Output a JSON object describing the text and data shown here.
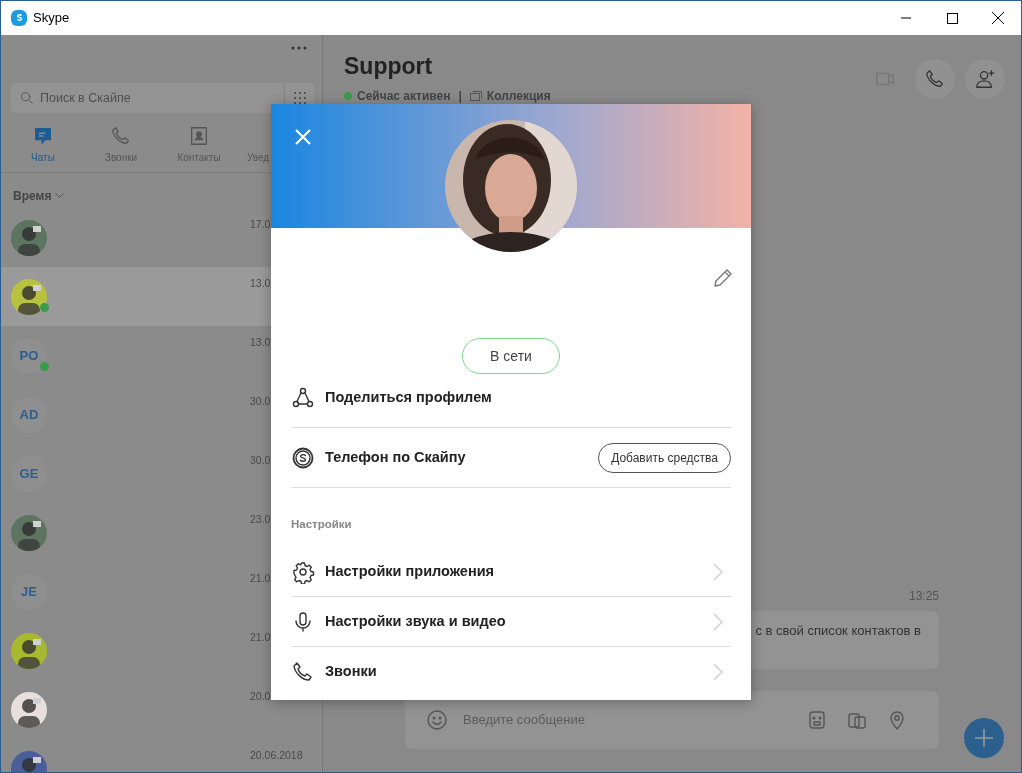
{
  "window": {
    "title": "Skype"
  },
  "sidebar": {
    "search": {
      "placeholder": "Поиск в Скайпе"
    },
    "tabs": [
      {
        "kind": "chats",
        "label": "Чаты",
        "selected": true
      },
      {
        "kind": "calls",
        "label": "Звонки",
        "selected": false
      },
      {
        "kind": "contacts",
        "label": "Контакты",
        "selected": false
      },
      {
        "kind": "notifications",
        "label": "Увед",
        "selected": false
      }
    ],
    "sort": {
      "label": "Время"
    },
    "conversations": [
      {
        "kind": "picture",
        "online": false,
        "selected": false,
        "date": "17.0"
      },
      {
        "kind": "picture",
        "online": true,
        "selected": true,
        "date": "13.0"
      },
      {
        "kind": "initials",
        "initials": "PO",
        "online": true,
        "selected": false,
        "date": "13.0"
      },
      {
        "kind": "initials",
        "initials": "AD",
        "online": false,
        "selected": false,
        "date": "30.0"
      },
      {
        "kind": "initials",
        "initials": "GE",
        "online": false,
        "selected": false,
        "date": "30.0"
      },
      {
        "kind": "picture",
        "online": false,
        "selected": false,
        "date": "23.0"
      },
      {
        "kind": "initials",
        "initials": "JE",
        "online": false,
        "selected": false,
        "date": "21.0"
      },
      {
        "kind": "picture",
        "online": false,
        "selected": false,
        "date": "21.0"
      },
      {
        "kind": "picture",
        "online": false,
        "selected": false,
        "date": "20.0"
      },
      {
        "kind": "picture",
        "online": false,
        "selected": false,
        "date": "20.06.2018"
      }
    ]
  },
  "chat": {
    "title": "Support",
    "presence": "Сейчас активен",
    "separator": "|",
    "collection": "Коллекция",
    "message": {
      "time": "13:25",
      "text": "с в свой список контактов в"
    },
    "composer": {
      "placeholder": "Введите сообщение"
    }
  },
  "profile_dialog": {
    "status": "В сети",
    "items": [
      {
        "kind": "share",
        "label": "Поделиться профилем"
      },
      {
        "kind": "skype-phone",
        "label": "Телефон по Скайпу",
        "button": "Добавить средства"
      }
    ],
    "section": "Настройки",
    "settings": [
      {
        "kind": "gear",
        "label": "Настройки приложения"
      },
      {
        "kind": "microphone",
        "label": "Настройки звука и видео"
      },
      {
        "kind": "phone",
        "label": "Звонки"
      }
    ]
  }
}
